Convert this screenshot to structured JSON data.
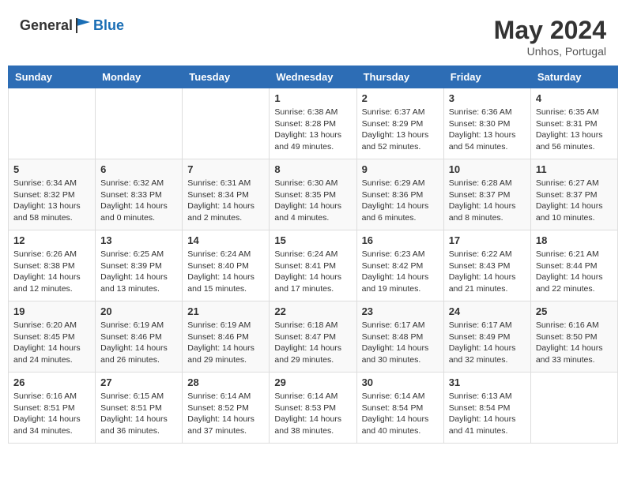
{
  "header": {
    "logo_general": "General",
    "logo_blue": "Blue",
    "month_year": "May 2024",
    "location": "Unhos, Portugal"
  },
  "calendar": {
    "days_of_week": [
      "Sunday",
      "Monday",
      "Tuesday",
      "Wednesday",
      "Thursday",
      "Friday",
      "Saturday"
    ],
    "weeks": [
      [
        {
          "day": "",
          "info": ""
        },
        {
          "day": "",
          "info": ""
        },
        {
          "day": "",
          "info": ""
        },
        {
          "day": "1",
          "info": "Sunrise: 6:38 AM\nSunset: 8:28 PM\nDaylight: 13 hours\nand 49 minutes."
        },
        {
          "day": "2",
          "info": "Sunrise: 6:37 AM\nSunset: 8:29 PM\nDaylight: 13 hours\nand 52 minutes."
        },
        {
          "day": "3",
          "info": "Sunrise: 6:36 AM\nSunset: 8:30 PM\nDaylight: 13 hours\nand 54 minutes."
        },
        {
          "day": "4",
          "info": "Sunrise: 6:35 AM\nSunset: 8:31 PM\nDaylight: 13 hours\nand 56 minutes."
        }
      ],
      [
        {
          "day": "5",
          "info": "Sunrise: 6:34 AM\nSunset: 8:32 PM\nDaylight: 13 hours\nand 58 minutes."
        },
        {
          "day": "6",
          "info": "Sunrise: 6:32 AM\nSunset: 8:33 PM\nDaylight: 14 hours\nand 0 minutes."
        },
        {
          "day": "7",
          "info": "Sunrise: 6:31 AM\nSunset: 8:34 PM\nDaylight: 14 hours\nand 2 minutes."
        },
        {
          "day": "8",
          "info": "Sunrise: 6:30 AM\nSunset: 8:35 PM\nDaylight: 14 hours\nand 4 minutes."
        },
        {
          "day": "9",
          "info": "Sunrise: 6:29 AM\nSunset: 8:36 PM\nDaylight: 14 hours\nand 6 minutes."
        },
        {
          "day": "10",
          "info": "Sunrise: 6:28 AM\nSunset: 8:37 PM\nDaylight: 14 hours\nand 8 minutes."
        },
        {
          "day": "11",
          "info": "Sunrise: 6:27 AM\nSunset: 8:37 PM\nDaylight: 14 hours\nand 10 minutes."
        }
      ],
      [
        {
          "day": "12",
          "info": "Sunrise: 6:26 AM\nSunset: 8:38 PM\nDaylight: 14 hours\nand 12 minutes."
        },
        {
          "day": "13",
          "info": "Sunrise: 6:25 AM\nSunset: 8:39 PM\nDaylight: 14 hours\nand 13 minutes."
        },
        {
          "day": "14",
          "info": "Sunrise: 6:24 AM\nSunset: 8:40 PM\nDaylight: 14 hours\nand 15 minutes."
        },
        {
          "day": "15",
          "info": "Sunrise: 6:24 AM\nSunset: 8:41 PM\nDaylight: 14 hours\nand 17 minutes."
        },
        {
          "day": "16",
          "info": "Sunrise: 6:23 AM\nSunset: 8:42 PM\nDaylight: 14 hours\nand 19 minutes."
        },
        {
          "day": "17",
          "info": "Sunrise: 6:22 AM\nSunset: 8:43 PM\nDaylight: 14 hours\nand 21 minutes."
        },
        {
          "day": "18",
          "info": "Sunrise: 6:21 AM\nSunset: 8:44 PM\nDaylight: 14 hours\nand 22 minutes."
        }
      ],
      [
        {
          "day": "19",
          "info": "Sunrise: 6:20 AM\nSunset: 8:45 PM\nDaylight: 14 hours\nand 24 minutes."
        },
        {
          "day": "20",
          "info": "Sunrise: 6:19 AM\nSunset: 8:46 PM\nDaylight: 14 hours\nand 26 minutes."
        },
        {
          "day": "21",
          "info": "Sunrise: 6:19 AM\nSunset: 8:46 PM\nDaylight: 14 hours\nand 29 minutes."
        },
        {
          "day": "22",
          "info": "Sunrise: 6:18 AM\nSunset: 8:47 PM\nDaylight: 14 hours\nand 29 minutes."
        },
        {
          "day": "23",
          "info": "Sunrise: 6:17 AM\nSunset: 8:48 PM\nDaylight: 14 hours\nand 30 minutes."
        },
        {
          "day": "24",
          "info": "Sunrise: 6:17 AM\nSunset: 8:49 PM\nDaylight: 14 hours\nand 32 minutes."
        },
        {
          "day": "25",
          "info": "Sunrise: 6:16 AM\nSunset: 8:50 PM\nDaylight: 14 hours\nand 33 minutes."
        }
      ],
      [
        {
          "day": "26",
          "info": "Sunrise: 6:16 AM\nSunset: 8:51 PM\nDaylight: 14 hours\nand 34 minutes."
        },
        {
          "day": "27",
          "info": "Sunrise: 6:15 AM\nSunset: 8:51 PM\nDaylight: 14 hours\nand 36 minutes."
        },
        {
          "day": "28",
          "info": "Sunrise: 6:14 AM\nSunset: 8:52 PM\nDaylight: 14 hours\nand 37 minutes."
        },
        {
          "day": "29",
          "info": "Sunrise: 6:14 AM\nSunset: 8:53 PM\nDaylight: 14 hours\nand 38 minutes."
        },
        {
          "day": "30",
          "info": "Sunrise: 6:14 AM\nSunset: 8:54 PM\nDaylight: 14 hours\nand 40 minutes."
        },
        {
          "day": "31",
          "info": "Sunrise: 6:13 AM\nSunset: 8:54 PM\nDaylight: 14 hours\nand 41 minutes."
        },
        {
          "day": "",
          "info": ""
        }
      ]
    ]
  }
}
